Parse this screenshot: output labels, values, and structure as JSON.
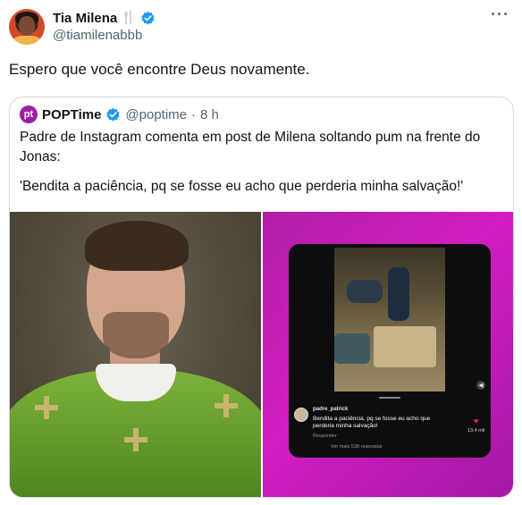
{
  "author": {
    "display_name": "Tia Milena",
    "emoji": "🍴",
    "handle": "@tiamilenabbb",
    "more_label": "···"
  },
  "tweet": {
    "text": "Espero que você encontre Deus novamente."
  },
  "quoted": {
    "avatar_text": "pt",
    "display_name": "POPTime",
    "handle": "@poptime",
    "separator": "·",
    "time": "8 h",
    "text_line1": "Padre de Instagram comenta em post de Milena soltando pum na frente do Jonas:",
    "text_line2": "'Bendita a paciência, pq se fosse eu acho que perderia minha salvação!'"
  },
  "embedded_comment": {
    "user": "padre_patrick",
    "text": "Bendita a paciência, pq se fosse eu acho que perderia minha salvação!",
    "reply_label": "Responder",
    "likes": "13,4 mil",
    "more_replies": "Ver mais 538 respostas"
  },
  "colors": {
    "verified_blue": "#1d9bf0",
    "text_primary": "#0f1419",
    "text_secondary": "#536471",
    "poptime_purple": "#9b1fa3",
    "magenta_bg": "#c41db6"
  }
}
